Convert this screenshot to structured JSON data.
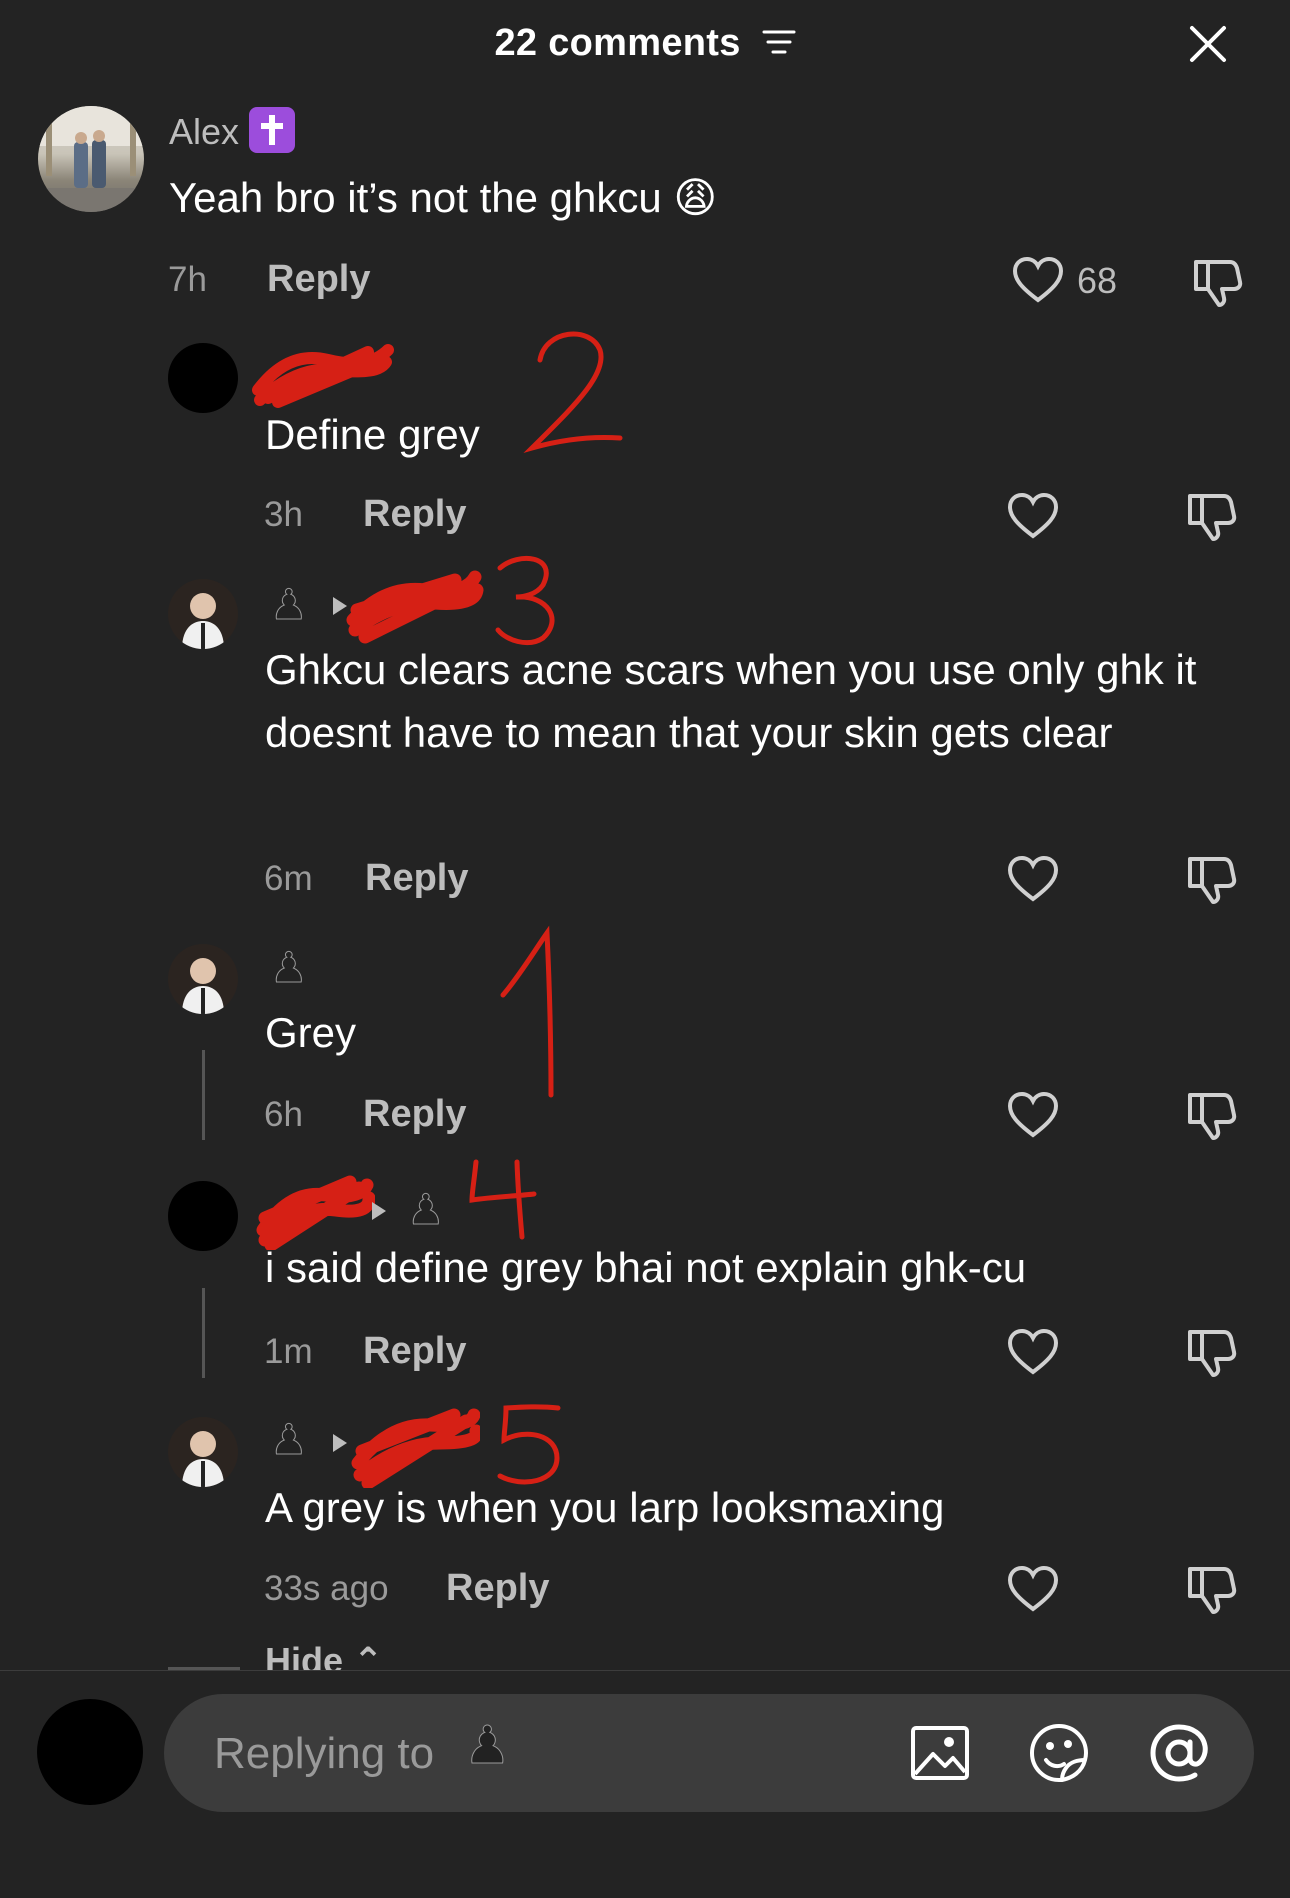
{
  "header": {
    "title": "22 comments",
    "filter_icon": "filter-icon",
    "close_icon": "close-icon"
  },
  "comments": [
    {
      "username": "Alex",
      "badge": "✝️",
      "text": "Yeah bro it’s not the ghkcu 😩",
      "time": "7h",
      "reply_label": "Reply",
      "likes": "68"
    },
    {
      "username": "",
      "text": "Define grey",
      "time": "3h",
      "reply_label": "Reply",
      "annotation": "2"
    },
    {
      "username": "",
      "text": "Ghkcu clears acne scars when you use only ghk it doesnt have to mean that your skin gets clear",
      "time": "6m",
      "reply_label": "Reply",
      "annotation": "3"
    },
    {
      "username": "",
      "text": "Grey",
      "time": "6h",
      "reply_label": "Reply",
      "annotation": "1"
    },
    {
      "username": "",
      "text": "i said define grey bhai not explain ghk-cu",
      "time": "1m",
      "reply_label": "Reply",
      "annotation": "4"
    },
    {
      "username": "",
      "text": "A grey is when you larp looksmaxing",
      "time": "33s ago",
      "reply_label": "Reply",
      "annotation": "5"
    }
  ],
  "hide_label": "Hide ⌃",
  "composer": {
    "placeholder": "Replying to",
    "pawn": "♟",
    "icons": [
      "image-icon",
      "sticker-icon",
      "mention-icon"
    ]
  },
  "colors": {
    "background": "#232323",
    "input": "#3c3c3c",
    "annotation_red": "#d62015"
  }
}
